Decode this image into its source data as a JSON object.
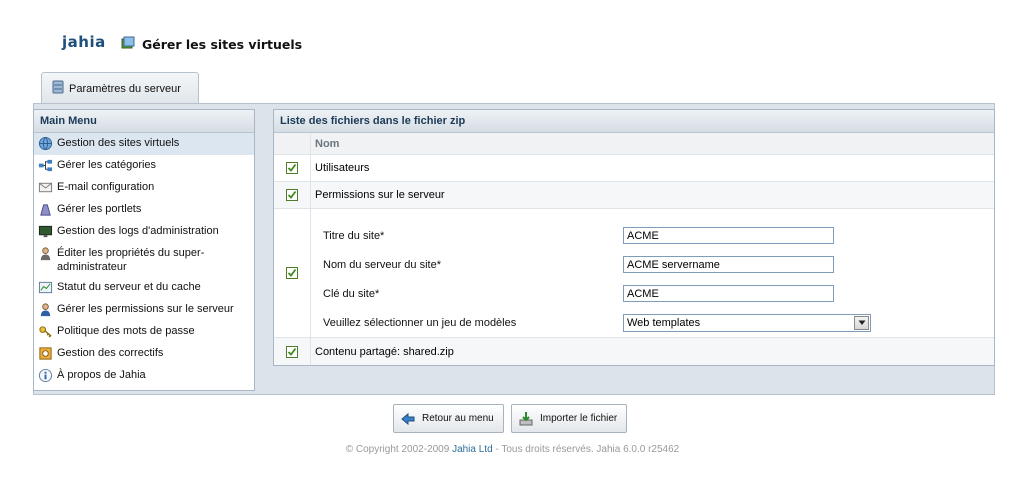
{
  "app": {
    "logo": "jahia",
    "title": "Gérer les sites virtuels"
  },
  "tab": {
    "label": "Paramètres du serveur"
  },
  "menu": {
    "header": "Main Menu",
    "items": [
      {
        "label": "Gestion des sites virtuels",
        "icon": "globe-icon"
      },
      {
        "label": "Gérer les catégories",
        "icon": "tree-icon"
      },
      {
        "label": "E-mail configuration",
        "icon": "envelope-icon"
      },
      {
        "label": "Gérer les portlets",
        "icon": "portlet-icon"
      },
      {
        "label": "Gestion des logs d'administration",
        "icon": "monitor-icon"
      },
      {
        "label": "Éditer les propriétés du super-administrateur",
        "icon": "admin-user-icon"
      },
      {
        "label": "Statut du serveur et du cache",
        "icon": "chart-icon"
      },
      {
        "label": "Gérer les permissions sur le serveur",
        "icon": "users-icon"
      },
      {
        "label": "Politique des mots de passe",
        "icon": "keys-icon"
      },
      {
        "label": "Gestion des correctifs",
        "icon": "patch-icon"
      },
      {
        "label": "À propos de Jahia",
        "icon": "info-icon"
      }
    ]
  },
  "content": {
    "header": "Liste des fichiers dans le fichier zip",
    "column_name": "Nom",
    "rows": [
      {
        "label": "Utilisateurs",
        "checked": true
      },
      {
        "label": "Permissions sur le serveur",
        "checked": true
      },
      {
        "label": "Contenu partagé: shared.zip",
        "checked": true
      }
    ],
    "form": {
      "site_title_label": "Titre du site*",
      "site_title_value": "ACME",
      "server_name_label": "Nom du serveur du site*",
      "server_name_value": "ACME servername",
      "site_key_label": "Clé du site*",
      "site_key_value": "ACME",
      "template_label": "Veuillez sélectionner un jeu de modèles",
      "template_value": "Web templates"
    }
  },
  "buttons": {
    "back": "Retour au menu",
    "import": "Importer le fichier"
  },
  "footer": {
    "prefix": "© Copyright 2002-2009 ",
    "company": "Jahia Ltd",
    "suffix": " - Tous droits réservés. Jahia 6.0.0 r25462"
  },
  "colors": {
    "accent": "#1d4e7c",
    "panel_bg": "#dce3ea",
    "check": "#3f8a1e"
  }
}
